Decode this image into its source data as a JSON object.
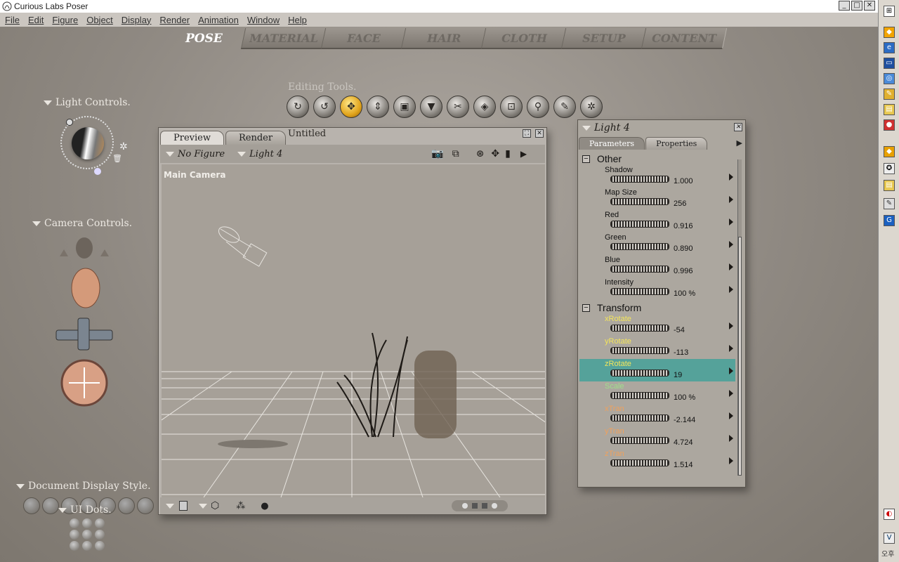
{
  "window": {
    "title": "Curious Labs Poser",
    "min": "_",
    "max": "□",
    "close": "✕"
  },
  "menu": [
    "File",
    "Edit",
    "Figure",
    "Object",
    "Display",
    "Render",
    "Animation",
    "Window",
    "Help"
  ],
  "room_tabs": [
    "POSE",
    "MATERIAL",
    "FACE",
    "HAIR",
    "CLOTH",
    "SETUP",
    "CONTENT"
  ],
  "editing_tools": {
    "label": "Editing Tools.",
    "items": [
      "rotate",
      "twist",
      "translate-pull",
      "translate-in-out",
      "scale",
      "taper",
      "chain-break",
      "color",
      "grouping",
      "view-magnifier",
      "morphing",
      "direct-manipulation"
    ],
    "selected": "translate-pull"
  },
  "light_controls": {
    "label": "Light Controls."
  },
  "camera_controls": {
    "label": "Camera Controls."
  },
  "document_display_style": {
    "label": "Document Display Style."
  },
  "ui_dots": {
    "label": "UI Dots."
  },
  "document": {
    "tabs": [
      "Preview",
      "Render"
    ],
    "active_tab": "Preview",
    "title": "Untitled",
    "figure_menu": "No Figure",
    "actor_menu": "Light 4",
    "viewport_label": "Main Camera"
  },
  "parameters": {
    "title": "Light 4",
    "tabs": [
      "Parameters",
      "Properties"
    ],
    "active_tab": "Parameters",
    "groups": [
      {
        "name": "Other",
        "rows": [
          {
            "label": "Shadow",
            "value": "1.000",
            "color": "#111111"
          },
          {
            "label": "Map Size",
            "value": "256",
            "color": "#111111"
          },
          {
            "label": "Red",
            "value": "0.916",
            "color": "#111111"
          },
          {
            "label": "Green",
            "value": "0.890",
            "color": "#111111"
          },
          {
            "label": "Blue",
            "value": "0.996",
            "color": "#111111"
          },
          {
            "label": "Intensity",
            "value": "100 %",
            "color": "#111111"
          }
        ]
      },
      {
        "name": "Transform",
        "rows": [
          {
            "label": "xRotate",
            "value": "-54",
            "color": "#f3e55b"
          },
          {
            "label": "yRotate",
            "value": "-113",
            "color": "#f3e55b"
          },
          {
            "label": "zRotate",
            "value": "19",
            "color": "#f3e55b"
          },
          {
            "label": "Scale",
            "value": "100 %",
            "color": "#9ee08a"
          },
          {
            "label": "xTran",
            "value": "-2.144",
            "color": "#f0a15c"
          },
          {
            "label": "yTran",
            "value": "4.724",
            "color": "#f0a15c"
          },
          {
            "label": "zTran",
            "value": "1.514",
            "color": "#f0a15c"
          }
        ]
      }
    ],
    "highlighted": "zRotate"
  },
  "taskbar": {
    "ime_label": "오후"
  }
}
